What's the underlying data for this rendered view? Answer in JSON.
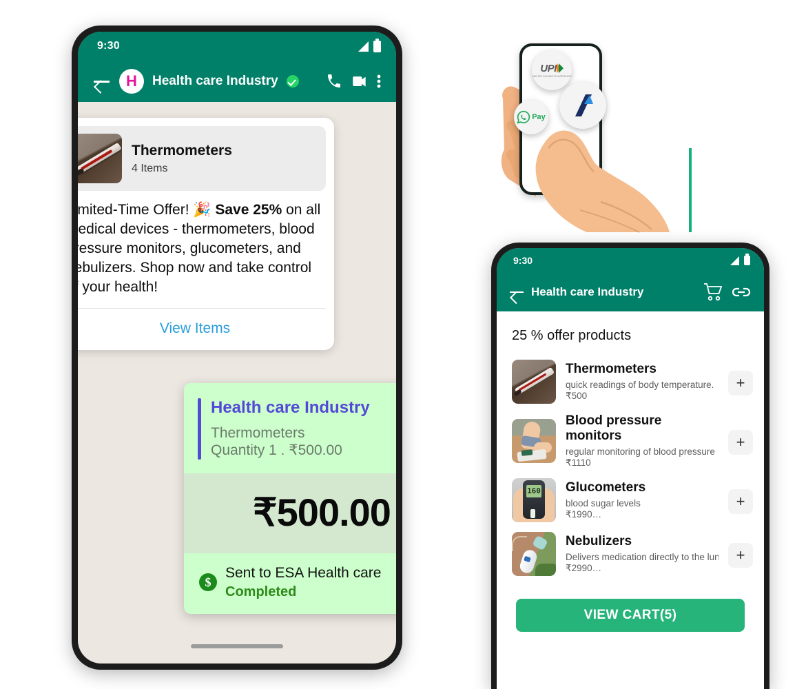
{
  "left_phone": {
    "status_bar": {
      "clock": "9:30",
      "signal_icon": "signal-icon",
      "battery_icon": "battery-icon"
    },
    "chat_header": {
      "back_icon": "back-arrow-icon",
      "avatar_letter": "H",
      "title": "Health care Industry",
      "verified_icon": "verified-badge-icon",
      "call_icon": "phone-call-icon",
      "video_icon": "video-call-icon",
      "menu_icon": "overflow-menu-icon"
    },
    "product_message": {
      "thumbnail": "thermometer-thumbnail",
      "product_name": "Thermometers",
      "item_count": "4 Items",
      "body_part1": "Limited-Time Offer! 🎉 ",
      "body_bold": "Save 25%",
      "body_part2": " on all medical devices - thermometers, blood pressure monitors, glucometers, and nebulizers.  Shop now and take control of your health!",
      "cta_label": "View Items"
    },
    "payment_receipt": {
      "merchant": "Health care Industry",
      "item": "Thermometers",
      "quantity_line": "Quantity 1 . ₹500.00",
      "amount": "₹500.00",
      "status_icon": "dollar-coin-icon",
      "sent_to": "Sent to ESA Health care",
      "status": "Completed"
    },
    "home_indicator": "home-indicator"
  },
  "illustration": {
    "alt": "hand-holding-phone-illustration",
    "badges": [
      {
        "name": "upi-logo-badge",
        "text": "UPI",
        "subtext": "UNIFIED PAYMENTS INTERFACE"
      },
      {
        "name": "whatsapp-pay-badge",
        "text": "Pay"
      },
      {
        "name": "bank-logo-badge",
        "text": ""
      }
    ]
  },
  "right_phone": {
    "status_bar": {
      "clock": "9:30",
      "signal_icon": "signal-icon",
      "battery_icon": "battery-icon"
    },
    "shop_header": {
      "back_icon": "back-arrow-icon",
      "title": "Health care Industry",
      "cart_icon": "shopping-cart-icon",
      "link_icon": "link-chain-icon"
    },
    "offer_title": "25 % offer products",
    "products": [
      {
        "thumbnail": "thermometer-thumbnail",
        "name": "Thermometers",
        "description": "quick readings of body temperature.",
        "price": "₹500",
        "add_label": "+"
      },
      {
        "thumbnail": "blood-pressure-monitor-thumbnail",
        "name": "Blood pressure monitors",
        "description": "regular monitoring of blood pressure",
        "price": "₹1110",
        "add_label": "+"
      },
      {
        "thumbnail": "glucometer-thumbnail",
        "name": "Glucometers",
        "description": "blood sugar levels",
        "price": "₹1990…",
        "add_label": "+"
      },
      {
        "thumbnail": "nebulizer-thumbnail",
        "name": "Nebulizers",
        "description": "Delivers medication directly to the lun…",
        "price": "₹2990…",
        "add_label": "+"
      }
    ],
    "view_cart_label": "VIEW CART(5)"
  },
  "colors": {
    "header_green": "#018069",
    "chat_background": "#ece7e1",
    "receipt_green": "#ccffcc",
    "receipt_band": "#d3e8cf",
    "accent_purple": "#5449d6",
    "cta_blue": "#2a9ddb",
    "cart_green": "#26b47a",
    "avatar_magenta": "#e5149b",
    "completed_green": "#2e8b19"
  }
}
